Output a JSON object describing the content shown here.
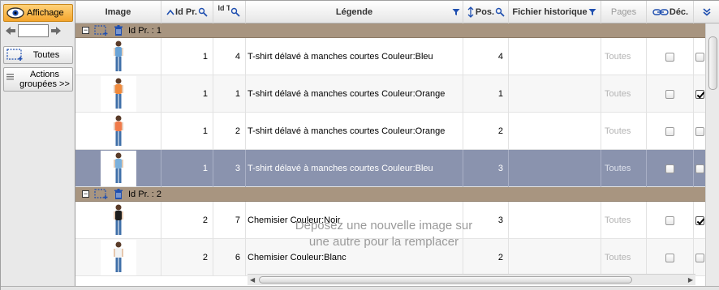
{
  "left_panel": {
    "affichage_label": "Affichage",
    "page_value": "",
    "toutes_label": "Toutes",
    "actions_label_line1": "Actions",
    "actions_label_line2": "groupées >>"
  },
  "columns": {
    "image": "Image",
    "id_pr": "Id Pr.",
    "id_t": "Id T...",
    "legende": "Légende",
    "pos": "Pos.",
    "fichier": "Fichier historique",
    "pages": "Pages",
    "dec": "Déc."
  },
  "groups": [
    {
      "label": "Id Pr. : 1",
      "rows": [
        {
          "id_pr": "1",
          "id_t": "4",
          "legende": "T-shirt délavé à manches courtes  Couleur:Bleu",
          "pos": "4",
          "fichier": "",
          "pages": "Toutes",
          "dec": false,
          "extra": false
        },
        {
          "id_pr": "1",
          "id_t": "1",
          "legende": "T-shirt délavé à manches courtes  Couleur:Orange",
          "pos": "1",
          "fichier": "",
          "pages": "Toutes",
          "dec": false,
          "extra": true
        },
        {
          "id_pr": "1",
          "id_t": "2",
          "legende": "T-shirt délavé à manches courtes  Couleur:Orange",
          "pos": "2",
          "fichier": "",
          "pages": "Toutes",
          "dec": false,
          "extra": false
        },
        {
          "id_pr": "1",
          "id_t": "3",
          "legende": "T-shirt délavé à manches courtes  Couleur:Bleu",
          "pos": "3",
          "fichier": "",
          "pages": "Toutes",
          "dec": false,
          "extra": false
        }
      ]
    },
    {
      "label": "Id Pr. : 2",
      "rows": [
        {
          "id_pr": "2",
          "id_t": "7",
          "legende": "Chemisier  Couleur:Noir",
          "pos": "3",
          "fichier": "",
          "pages": "Toutes",
          "dec": false,
          "extra": true
        },
        {
          "id_pr": "2",
          "id_t": "6",
          "legende": "Chemisier  Couleur:Blanc",
          "pos": "2",
          "fichier": "",
          "pages": "Toutes",
          "dec": false,
          "extra": false
        }
      ]
    }
  ],
  "drop_hint_line1": "Déposez une nouvelle image sur",
  "drop_hint_line2": "une autre pour la remplacer",
  "colors": {
    "group_bar": "#a89580",
    "selected_row": "#8a93ae",
    "affichage_button": "#f4a52c",
    "icon_blue": "#1f4fb0"
  },
  "icons": {
    "eye": "eye-icon",
    "prev": "arrow-left-icon",
    "next": "arrow-right-icon",
    "select_all": "select-all-icon",
    "actions": "menu-icon",
    "sort_up": "sort-up-icon",
    "search": "search-icon",
    "filter": "filter-icon",
    "reorder": "reorder-icon",
    "link": "link-icon",
    "expand_all": "double-chevron-down-icon",
    "trash": "trash-icon"
  }
}
